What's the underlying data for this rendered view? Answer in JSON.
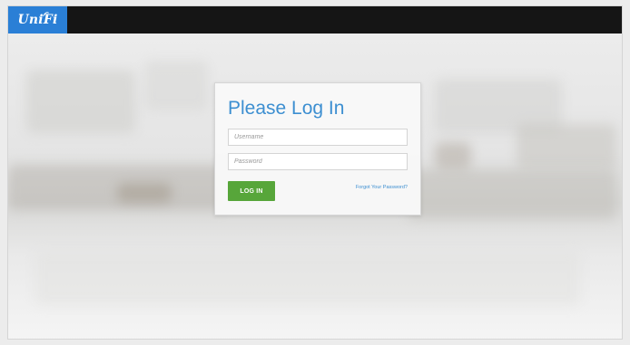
{
  "header": {
    "logo_text": "UniFi",
    "brand_color": "#2a7fd6",
    "bar_color": "#151515"
  },
  "login": {
    "title": "Please Log In",
    "username_placeholder": "Username",
    "password_placeholder": "Password",
    "login_button_label": "LOG IN",
    "forgot_password_label": "Forgot Your Password?",
    "title_color": "#3d8fd1",
    "button_color": "#57a63a"
  }
}
